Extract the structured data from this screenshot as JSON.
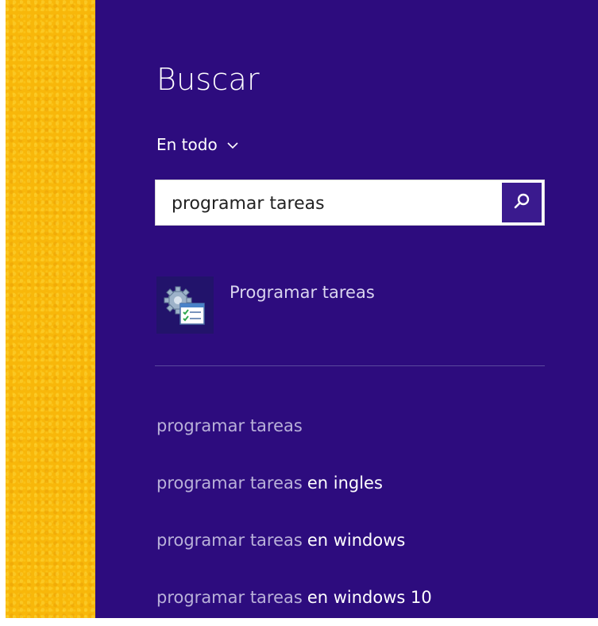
{
  "panel": {
    "title": "Buscar",
    "scope_label": "En todo"
  },
  "search": {
    "value": "programar tareas"
  },
  "results": {
    "app_label": "Programar tareas"
  },
  "suggestions": [
    {
      "query": "programar tareas",
      "rest": ""
    },
    {
      "query": "programar tareas",
      "rest": "en ingles"
    },
    {
      "query": "programar tareas",
      "rest": "en windows"
    },
    {
      "query": "programar tareas",
      "rest": "en windows 10"
    }
  ],
  "icons": {
    "scope_dropdown": "chevron-down-icon",
    "search_button": "search-icon",
    "app": "task-scheduler-icon"
  },
  "colors": {
    "panel_bg": "#2d0c7e",
    "search_button_bg": "#3a1a8e",
    "left_strip": "#f8b70a"
  }
}
